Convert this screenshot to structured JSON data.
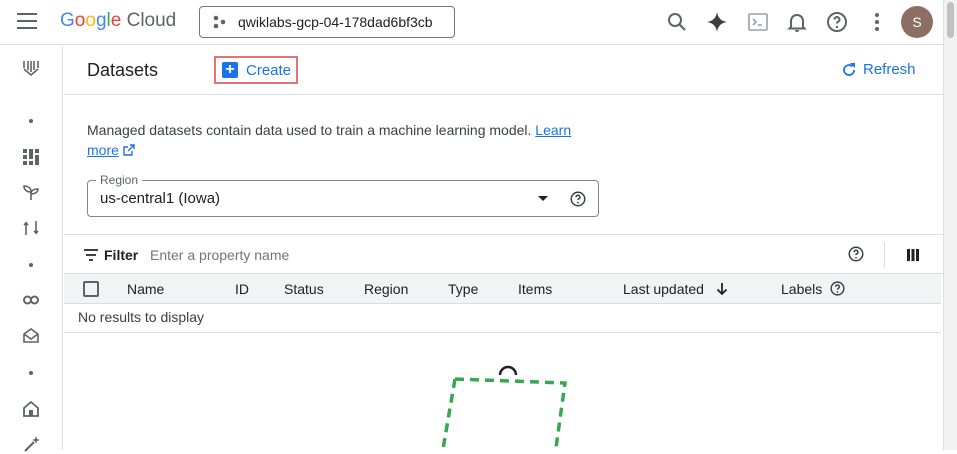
{
  "app": {
    "brand_google": "Google",
    "brand_cloud": "Cloud",
    "project": "qwiklabs-gcp-04-178dad6bf3cb",
    "avatar_initial": "S"
  },
  "page": {
    "title": "Datasets",
    "create_label": "Create",
    "refresh_label": "Refresh",
    "description": "Managed datasets contain data used to train a machine learning model.",
    "learn_more_1": "Learn",
    "learn_more_2": "more"
  },
  "region": {
    "label": "Region",
    "value": "us-central1 (Iowa)"
  },
  "filter": {
    "label": "Filter",
    "placeholder": "Enter a property name"
  },
  "table": {
    "columns": [
      "Name",
      "ID",
      "Status",
      "Region",
      "Type",
      "Items",
      "Last updated",
      "Labels"
    ],
    "empty": "No results to display"
  },
  "colors": {
    "accent": "#1a73e8",
    "create_highlight": "#e57373",
    "illustration_green": "#34a853"
  }
}
